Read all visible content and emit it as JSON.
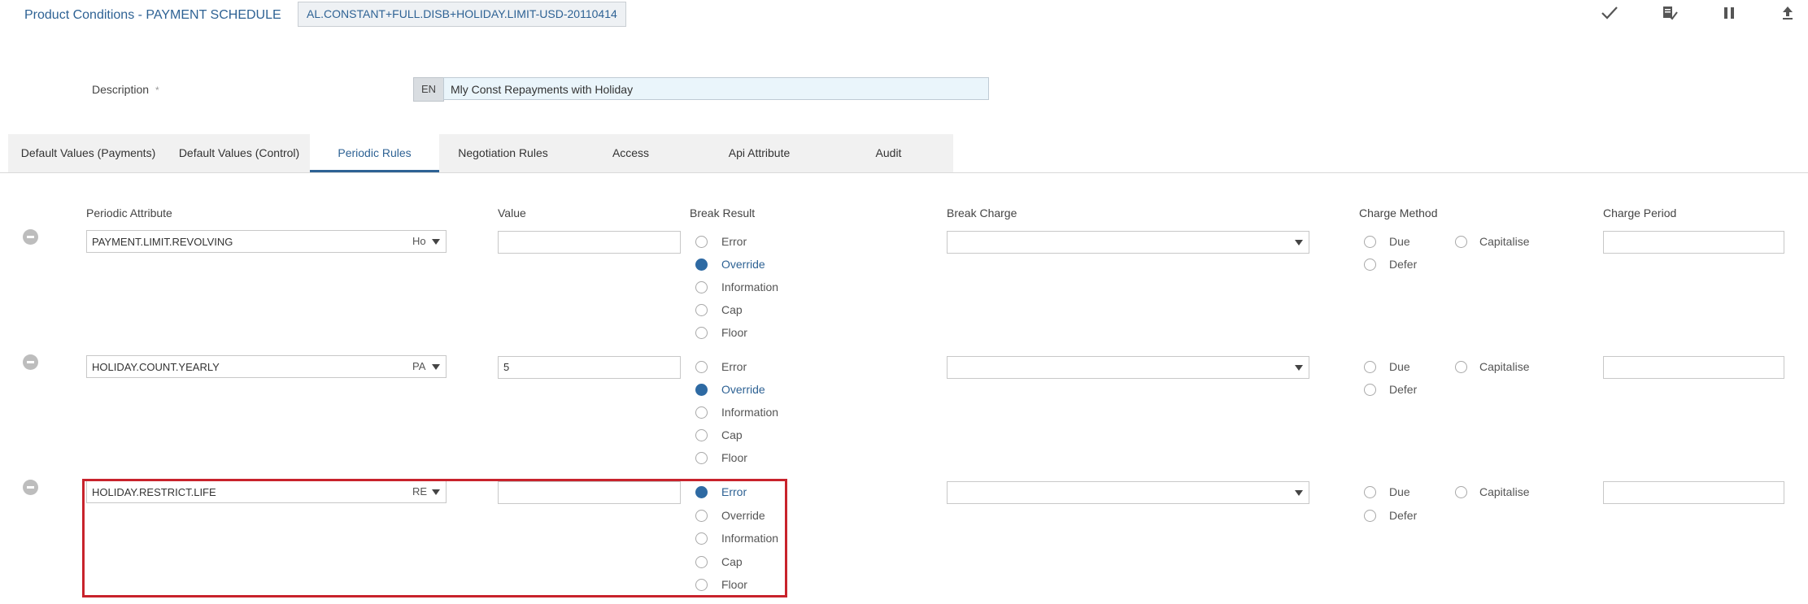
{
  "header": {
    "title": "Product Conditions - PAYMENT SCHEDULE",
    "record_id": "AL.CONSTANT+FULL.DISB+HOLIDAY.LIMIT-USD-20110414",
    "toolbar": [
      "check-icon",
      "validate-icon",
      "hold-icon",
      "commit-icon"
    ]
  },
  "description": {
    "label": "Description",
    "required_marker": "*",
    "lang": "EN",
    "value": "Mly Const Repayments with Holiday"
  },
  "tabs": [
    {
      "label": "Default Values (Payments)",
      "active": false
    },
    {
      "label": "Default Values (Control)",
      "active": false
    },
    {
      "label": "Periodic Rules",
      "active": true
    },
    {
      "label": "Negotiation Rules",
      "active": false
    },
    {
      "label": "Access",
      "active": false
    },
    {
      "label": "Api Attribute",
      "active": false
    },
    {
      "label": "Audit",
      "active": false
    }
  ],
  "columns": {
    "periodic_attribute": "Periodic Attribute",
    "value": "Value",
    "break_result": "Break Result",
    "break_charge": "Break Charge",
    "charge_method": "Charge Method",
    "charge_period": "Charge Period"
  },
  "break_options": [
    "Error",
    "Override",
    "Information",
    "Cap",
    "Floor"
  ],
  "method_options": {
    "due": "Due",
    "defer": "Defer",
    "capitalise": "Capitalise"
  },
  "rows": [
    {
      "attribute": "PAYMENT.LIMIT.REVOLVING",
      "short": "Ho",
      "value": "",
      "break_result": "Override",
      "highlighted": false
    },
    {
      "attribute": "HOLIDAY.COUNT.YEARLY",
      "short": "PA",
      "value": "5",
      "break_result": "Override",
      "highlighted": false
    },
    {
      "attribute": "HOLIDAY.RESTRICT.LIFE",
      "short": "RE",
      "value": "",
      "break_result": "Error",
      "highlighted": true
    }
  ],
  "colors": {
    "accent": "#2e6294",
    "radio_selected": "#2e6aa3",
    "highlight_border": "#c8232c",
    "description_bg": "#eaf5fb"
  }
}
